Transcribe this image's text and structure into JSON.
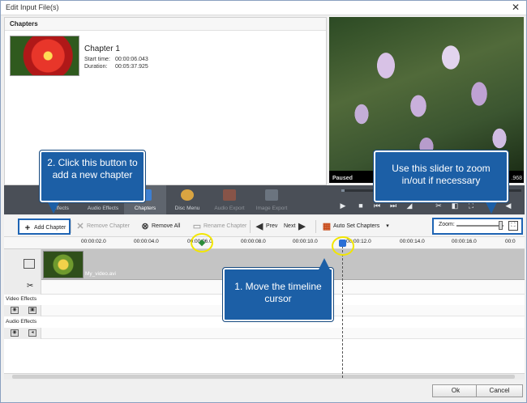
{
  "window": {
    "title": "Edit Input File(s)",
    "close_glyph": "✕"
  },
  "chapters": {
    "header": "Chapters",
    "items": [
      {
        "name": "Chapter 1",
        "start_label": "Start time:",
        "start_value": "00:00:06.043",
        "duration_label": "Duration:",
        "duration_value": "00:05:37.925"
      }
    ]
  },
  "preview": {
    "status": "Paused",
    "time": ".968"
  },
  "tabs": [
    {
      "label": "Effects",
      "icon": "effects-icon"
    },
    {
      "label": "Audio Effects",
      "icon": "audio-effects-icon"
    },
    {
      "label": "Chapters",
      "icon": "chapters-icon"
    },
    {
      "label": "Disc Menu",
      "icon": "disc-menu-icon"
    },
    {
      "label": "Audio Export",
      "icon": "audio-export-icon"
    },
    {
      "label": "Image Export",
      "icon": "image-export-icon"
    }
  ],
  "toolbar": {
    "add_chapter": "Add Chapter",
    "remove_chapter": "Remove Chapter",
    "remove_all": "Remove All",
    "rename_chapter": "Rename Chapter",
    "prev": "Prev",
    "next": "Next",
    "auto_set_chapters": "Auto Set Chapters",
    "zoom_label": "Zoom:",
    "zoom_level": 0.9
  },
  "timeline": {
    "ruler": [
      "00:00:02.0",
      "00:00:04.0",
      "00:00:06.0",
      "00:00:08.0",
      "00:00:10.0",
      "00:00:12.0",
      "00:00:14.0",
      "00:00:16.0",
      "00:0"
    ],
    "clip_name": "My_video.avi",
    "video_effects_label": "Video Effects",
    "audio_effects_label": "Audio Effects"
  },
  "buttons": {
    "ok": "Ok",
    "cancel": "Cancel"
  },
  "callouts": {
    "add_chapter": "2. Click this button to add a new chapter",
    "zoom": "Use this slider to zoom in/out if necessary",
    "cursor": "1. Move the timeline cursor"
  },
  "colors": {
    "accent": "#1e64b4",
    "callout": "#1c5fa6",
    "highlight": "#f2e600",
    "dark_toolbar": "#4a4f57"
  }
}
